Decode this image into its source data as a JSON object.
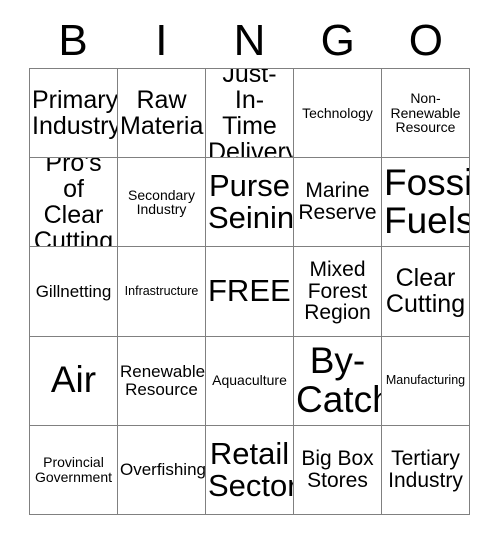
{
  "card": {
    "title_letters": [
      "B",
      "I",
      "N",
      "G",
      "O"
    ],
    "columns": 5,
    "rows": 5,
    "border_color": "#808080",
    "text_color": "#000000",
    "background_color": "#ffffff",
    "free_space_label": "FREE!",
    "cells": [
      {
        "text": "Primary Industry",
        "size": "lg"
      },
      {
        "text": "Raw Material",
        "size": "lg"
      },
      {
        "text": "Just-In-Time Delivery",
        "size": "lg"
      },
      {
        "text": "Technology",
        "size": "xs"
      },
      {
        "text": "Non-Renewable Resource",
        "size": "xs"
      },
      {
        "text": "Pro's of Clear Cutting",
        "size": "lg"
      },
      {
        "text": "Secondary Industry",
        "size": "xs"
      },
      {
        "text": "Purse Seining",
        "size": "xl"
      },
      {
        "text": "Marine Reserve",
        "size": "md"
      },
      {
        "text": "Fossil Fuels",
        "size": "xxl"
      },
      {
        "text": "Gillnetting",
        "size": "sm"
      },
      {
        "text": "Infrastructure",
        "size": "xxs"
      },
      {
        "text": "FREE!",
        "size": "xl"
      },
      {
        "text": "Mixed Forest Region",
        "size": "md"
      },
      {
        "text": "Clear Cutting",
        "size": "lg"
      },
      {
        "text": "Air",
        "size": "xxl"
      },
      {
        "text": "Renewable Resource",
        "size": "sm"
      },
      {
        "text": "Aquaculture",
        "size": "xs"
      },
      {
        "text": "By-Catch",
        "size": "xxl"
      },
      {
        "text": "Manufacturing",
        "size": "xxs"
      },
      {
        "text": "Provincial Government",
        "size": "xs"
      },
      {
        "text": "Overfishing",
        "size": "sm"
      },
      {
        "text": "Retail Sector",
        "size": "xl"
      },
      {
        "text": "Big Box Stores",
        "size": "md"
      },
      {
        "text": "Tertiary Industry",
        "size": "md"
      }
    ]
  }
}
